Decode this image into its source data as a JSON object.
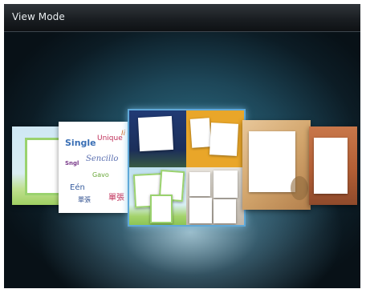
{
  "header": {
    "title": "View Mode"
  },
  "theme": {
    "accent": "#5fa8d8",
    "header_bg": "#1a1e22",
    "stage_bg": "#1d4658"
  },
  "cards": [
    {
      "name": "template-single-green"
    },
    {
      "name": "template-single-text"
    },
    {
      "name": "template-group-selected",
      "selected": true
    },
    {
      "name": "template-single-wood"
    },
    {
      "name": "template-single-rust"
    }
  ],
  "collage_words": [
    "Single",
    "Unique",
    "Sencillo",
    "Eén",
    "Gavo",
    "單張",
    "單張"
  ]
}
